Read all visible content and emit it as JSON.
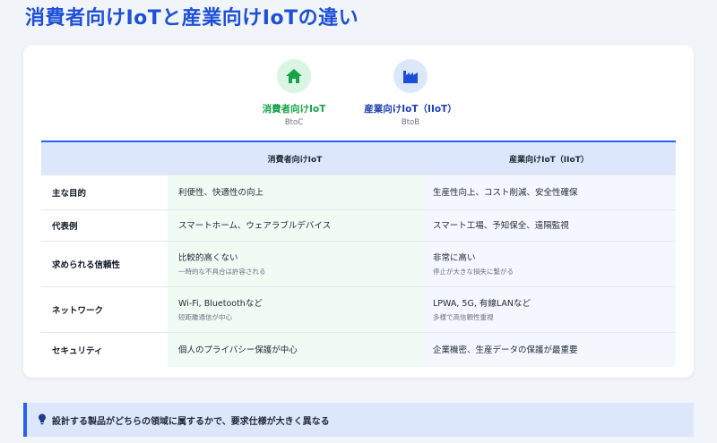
{
  "page": {
    "title": "消費者向けIoTと産業向けIoTの違い"
  },
  "legend": {
    "consumer": {
      "name": "消費者向けIoT",
      "sub": "BtoC",
      "icon": "house-icon",
      "color": "#16a34a"
    },
    "industrial": {
      "name": "産業向けIoT（IIoT）",
      "sub": "BtoB",
      "icon": "factory-icon",
      "color": "#1d4ed8"
    }
  },
  "table": {
    "headers": [
      "",
      "消費者向けIoT",
      "産業向けIoT（IIoT）"
    ],
    "rows": [
      {
        "label": "主な目的",
        "consumer": "利便性、快適性の向上",
        "consumer_note": "",
        "industrial": "生産性向上、コスト削減、安全性確保",
        "industrial_note": ""
      },
      {
        "label": "代表例",
        "consumer": "スマートホーム、ウェアラブルデバイス",
        "consumer_note": "",
        "industrial": "スマート工場、予知保全、遠隔監視",
        "industrial_note": ""
      },
      {
        "label": "求められる信頼性",
        "consumer": "比較的高くない",
        "consumer_note": "一時的な不具合は許容される",
        "industrial": "非常に高い",
        "industrial_note": "停止が大きな損失に繋がる"
      },
      {
        "label": "ネットワーク",
        "consumer": "Wi-Fi, Bluetoothなど",
        "consumer_note": "短距離通信が中心",
        "industrial": "LPWA, 5G, 有線LANなど",
        "industrial_note": "多様で高信頼性重視"
      },
      {
        "label": "セキュリティ",
        "consumer": "個人のプライバシー保護が中心",
        "consumer_note": "",
        "industrial": "企業機密、生産データの保護が最重要",
        "industrial_note": ""
      }
    ]
  },
  "note": {
    "icon": "lightbulb-icon",
    "text": "設計する製品がどちらの領域に属するかで、要求仕様が大きく異なる"
  },
  "colors": {
    "accent": "#2563eb",
    "consumer": "#16a34a",
    "industrial": "#1e40af"
  }
}
